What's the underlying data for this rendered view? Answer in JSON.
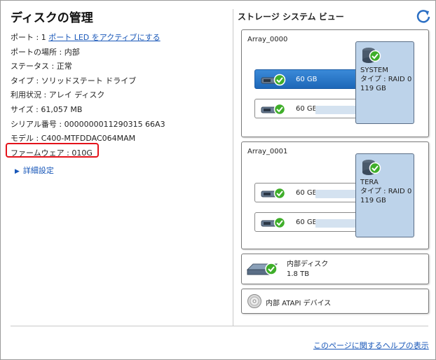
{
  "page": {
    "title": "ディスクの管理"
  },
  "details": {
    "port_label": "ポート : 1",
    "port_link": "ポート LED をアクティブにする",
    "location": "ポートの場所 : 内部",
    "status": "ステータス : 正常",
    "type": "タイプ : ソリッドステート ドライブ",
    "usage": "利用状況 : アレイ ディスク",
    "size": "サイズ : 61,057 MB",
    "serial": "シリアル番号 : 0000000011290315 66A3",
    "model": "モデル : C400-MTFDDAC064MAM",
    "firmware": "ファームウェア : 010G",
    "advanced": "詳細設定"
  },
  "storage": {
    "title": "ストレージ システム ビュー",
    "arrays": [
      {
        "name": "Array_0000",
        "disks": [
          {
            "size": "60 GB",
            "selected": true
          },
          {
            "size": "60 GB",
            "selected": false
          }
        ],
        "volume": {
          "name": "SYSTEM",
          "type": "タイプ : RAID 0",
          "size": "119 GB"
        }
      },
      {
        "name": "Array_0001",
        "disks": [
          {
            "size": "60 GB",
            "selected": false
          },
          {
            "size": "60 GB",
            "selected": false
          }
        ],
        "volume": {
          "name": "TERA",
          "type": "タイプ : RAID 0",
          "size": "119 GB"
        }
      }
    ],
    "internal_disk": {
      "name": "内部ディスク",
      "size": "1.8 TB"
    },
    "atapi": {
      "name": "内部 ATAPI デバイス"
    }
  },
  "footer": {
    "help_link": "このページに関するヘルプの表示"
  },
  "colors": {
    "link": "#1756b8",
    "highlight": "#e4121a",
    "selected_disk": "#1d67b8",
    "volume": "#bdd3ea",
    "check": "#3fae2a"
  }
}
